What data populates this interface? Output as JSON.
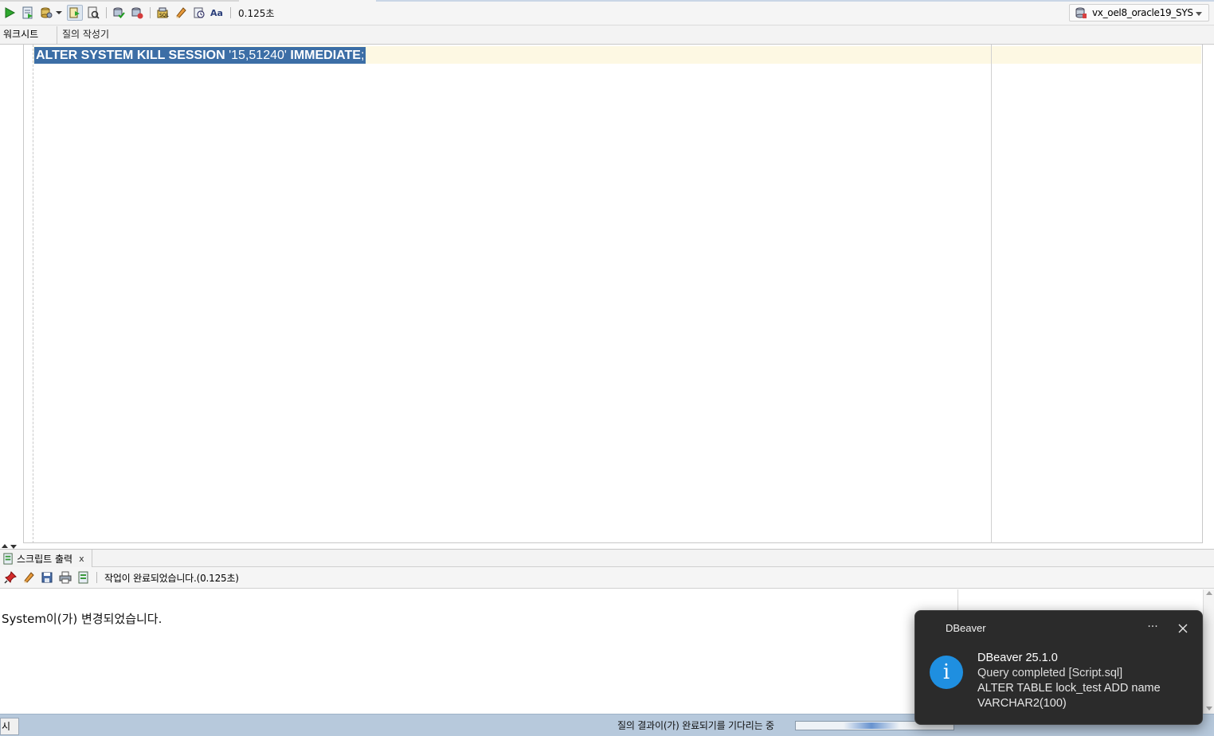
{
  "toolbar": {
    "timing": "0.125초"
  },
  "connection": {
    "label": "vx_oel8_oracle19_SYS"
  },
  "tabs": [
    {
      "label": "워크시트"
    },
    {
      "label": "질의 작성기"
    }
  ],
  "editor": {
    "sql_keyword_1": "ALTER SYSTEM KILL SESSION",
    "sql_string": " '15,51240' ",
    "sql_keyword_2": "IMMEDIATE",
    "sql_terminator": ";"
  },
  "output": {
    "tab_label": "스크립트 출력",
    "tab_close": "x",
    "status": "작업이 완료되었습니다.(0.125초)",
    "message": "System이(가) 변경되었습니다."
  },
  "statusbar": {
    "left_fragment": "시오.",
    "wait_text": "질의 결과이(가) 완료되기를 기다리는 중"
  },
  "notification": {
    "app": "DBeaver",
    "more": "···",
    "title": "DBeaver 25.1.0",
    "subtitle": "Query completed [Script.sql]",
    "query_line_1": "ALTER TABLE lock_test ADD name",
    "query_line_2": "VARCHAR2(100)",
    "icon_glyph": "i"
  }
}
